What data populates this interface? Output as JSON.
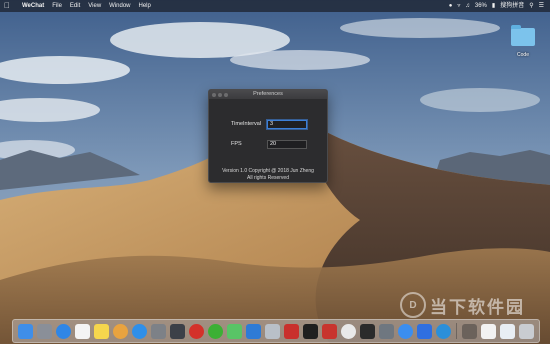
{
  "menubar": {
    "app_name": "WeChat",
    "items": [
      "File",
      "Edit",
      "View",
      "Window",
      "Help"
    ],
    "battery": "36%",
    "input_method": "搜狗拼音"
  },
  "desktop": {
    "folder_label": "Code"
  },
  "preferences": {
    "title": "Preferences",
    "time_interval_label": "TimeInterval",
    "time_interval_value": "3",
    "fps_label": "FPS",
    "fps_value": "20",
    "copyright": "Version 1.0 Copyright @ 2018 Jun Zheng",
    "rights": "All rights Reserved"
  },
  "watermark": {
    "text": "当下软件园"
  },
  "dock": {
    "icons": [
      {
        "name": "finder-icon",
        "color": "#3f8ee8"
      },
      {
        "name": "launchpad-icon",
        "color": "#8a8f98"
      },
      {
        "name": "safari-icon",
        "color": "#2f86e6"
      },
      {
        "name": "calendar-icon",
        "color": "#f4f4f4"
      },
      {
        "name": "notes-icon",
        "color": "#f6d64d"
      },
      {
        "name": "photos-icon",
        "color": "#e9a33f"
      },
      {
        "name": "app-store-icon",
        "color": "#2f8fe8"
      },
      {
        "name": "system-preferences-icon",
        "color": "#7d8187"
      },
      {
        "name": "quicktime-icon",
        "color": "#3c4048"
      },
      {
        "name": "netease-music-icon",
        "color": "#d4312a"
      },
      {
        "name": "wechat-icon",
        "color": "#3cb034"
      },
      {
        "name": "messages-icon",
        "color": "#59c466"
      },
      {
        "name": "xcode-icon",
        "color": "#2e7bd6"
      },
      {
        "name": "preview-icon",
        "color": "#b9c0c8"
      },
      {
        "name": "photo-booth-icon",
        "color": "#c9302c"
      },
      {
        "name": "terminal-icon",
        "color": "#1f1f1f"
      },
      {
        "name": "parallels-icon",
        "color": "#c8342e"
      },
      {
        "name": "chrome-icon",
        "color": "#e9e9e9"
      },
      {
        "name": "pycharm-icon",
        "color": "#2b2b2b"
      },
      {
        "name": "utilities-icon",
        "color": "#6f7780"
      },
      {
        "name": "baidu-netdisk-icon",
        "color": "#3b8ef0"
      },
      {
        "name": "feishu-icon",
        "color": "#2f6fe0"
      },
      {
        "name": "edge-icon",
        "color": "#2b8fd9"
      }
    ],
    "docs": [
      {
        "name": "document-thumbnail-icon",
        "color": "#6b625b"
      },
      {
        "name": "screenshot-thumbnail-icon",
        "color": "#f2f2f2"
      },
      {
        "name": "window-thumbnail-icon",
        "color": "#e8eef4"
      },
      {
        "name": "trash-icon",
        "color": "#c9ccd1"
      }
    ]
  }
}
